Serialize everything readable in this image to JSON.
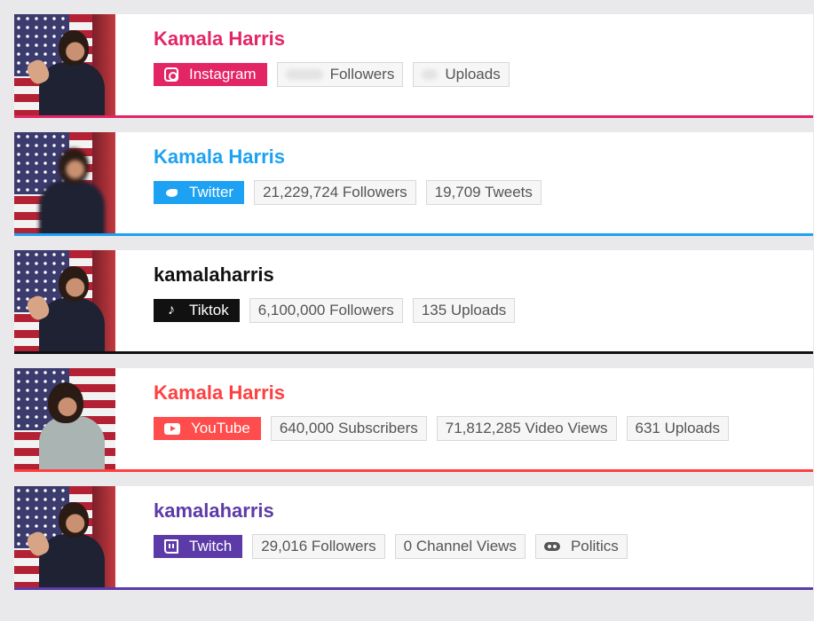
{
  "cards": [
    {
      "name": "Kamala Harris",
      "color": "#e42565",
      "platform": "Instagram",
      "platform_icon": "instagram-icon",
      "stats": [
        {
          "label": "Followers",
          "blurred": true
        },
        {
          "label": "Uploads",
          "blurred": true
        }
      ]
    },
    {
      "name": "Kamala Harris",
      "color": "#1da1f2",
      "platform": "Twitter",
      "platform_icon": "twitter-bird-icon",
      "stats": [
        {
          "label": "21,229,724 Followers"
        },
        {
          "label": "19,709 Tweets"
        }
      ]
    },
    {
      "name": "kamalaharris",
      "color": "#111111",
      "platform": "Tiktok",
      "platform_icon": "tiktok-note-icon",
      "stats": [
        {
          "label": "6,100,000 Followers"
        },
        {
          "label": "135 Uploads"
        }
      ]
    },
    {
      "name": "Kamala Harris",
      "color": "#ff4040",
      "platform": "YouTube",
      "platform_icon": "youtube-play-icon",
      "stats": [
        {
          "label": "640,000 Subscribers"
        },
        {
          "label": "71,812,285 Video Views"
        },
        {
          "label": "631 Uploads"
        }
      ]
    },
    {
      "name": "kamalaharris",
      "color": "#5c3ba8",
      "platform": "Twitch",
      "platform_icon": "twitch-icon",
      "stats": [
        {
          "label": "29,016 Followers"
        },
        {
          "label": "0 Channel Views"
        },
        {
          "label": "Politics",
          "icon": "gamepad-icon"
        }
      ]
    }
  ]
}
